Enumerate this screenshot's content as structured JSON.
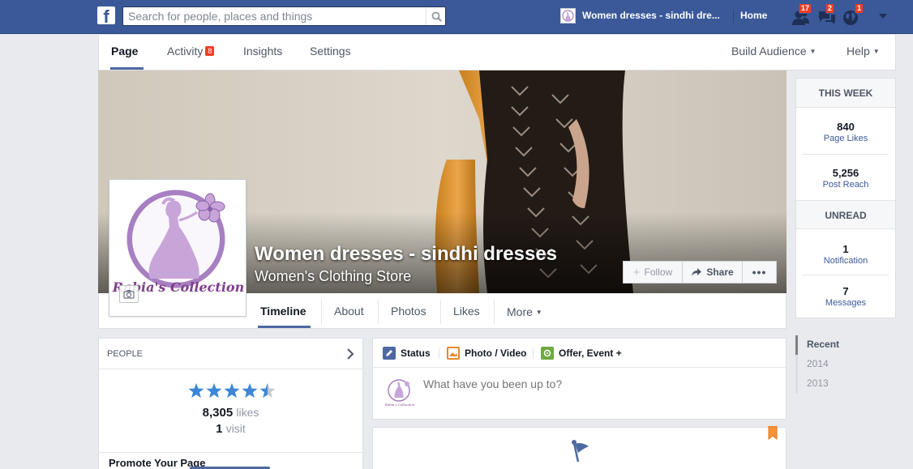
{
  "topbar": {
    "search_placeholder": "Search for people, places and things",
    "page_name": "Women dresses - sindhi dre...",
    "home_label": "Home",
    "friend_requests_count": "17",
    "messages_count": "2",
    "notifications_count": "1"
  },
  "admin": {
    "tabs": [
      {
        "label": "Page"
      },
      {
        "label": "Activity",
        "count": "8"
      },
      {
        "label": "Insights"
      },
      {
        "label": "Settings"
      }
    ],
    "build_audience": "Build Audience",
    "help": "Help"
  },
  "cover": {
    "title": "Women dresses - sindhi dresses",
    "category": "Women's Clothing Store",
    "follow_label": "Follow",
    "share_label": "Share",
    "more_label": "•••"
  },
  "profile": {
    "logo_text": "Rabia's Collection"
  },
  "timeline_nav": {
    "tabs": [
      "Timeline",
      "About",
      "Photos",
      "Likes",
      "More"
    ]
  },
  "this_week": {
    "heading": "THIS WEEK",
    "page_likes": "840",
    "page_likes_label": "Page Likes",
    "post_reach": "5,256",
    "post_reach_label": "Post Reach",
    "unread_heading": "UNREAD",
    "notifications": "1",
    "notifications_label": "Notification",
    "messages": "7",
    "messages_label": "Messages"
  },
  "years": [
    "Recent",
    "2014",
    "2013"
  ],
  "people": {
    "heading": "PEOPLE",
    "rating": 4.5,
    "likes_count": "8,305",
    "likes_label": "likes",
    "visit_count": "1",
    "visit_label": "visit",
    "promote_label": "Promote Your Page"
  },
  "composer": {
    "status_label": "Status",
    "photo_label": "Photo / Video",
    "offer_label": "Offer, Event +",
    "placeholder": "What have you been up to?"
  },
  "colors": {
    "brand_blue": "#3b5998",
    "badge_red": "#f03d25",
    "logo_purple": "#a77fc2"
  }
}
